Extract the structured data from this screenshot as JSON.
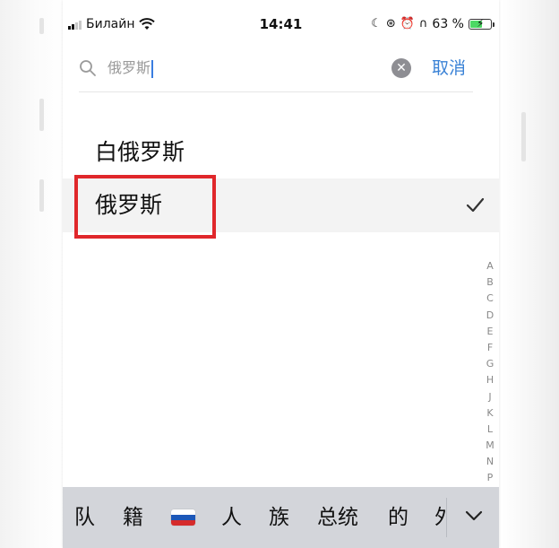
{
  "status_bar": {
    "carrier": "Билайн",
    "time": "14:41",
    "battery_percent": "63 %",
    "battery_level": 0.63,
    "battery_color": "#4cd964",
    "icons": [
      "signal-icon",
      "wifi-icon",
      "moon-icon",
      "rotation-lock-icon",
      "alarm-icon",
      "headphones-icon",
      "battery-icon"
    ]
  },
  "search": {
    "query": "俄罗斯",
    "cancel_label": "取消",
    "accent_color": "#3a82d6"
  },
  "results": [
    {
      "label": "白俄罗斯",
      "selected": false
    },
    {
      "label": "俄罗斯",
      "selected": true
    }
  ],
  "highlight_color": "#e0272b",
  "index_letters": [
    "A",
    "B",
    "C",
    "D",
    "E",
    "F",
    "G",
    "H",
    "J",
    "K",
    "L",
    "M",
    "N",
    "P"
  ],
  "keyboard_suggestions": [
    "队",
    "籍",
    "人",
    "族",
    "总统",
    "的",
    "外"
  ],
  "suggestion_emoji": "russia-flag-emoji"
}
